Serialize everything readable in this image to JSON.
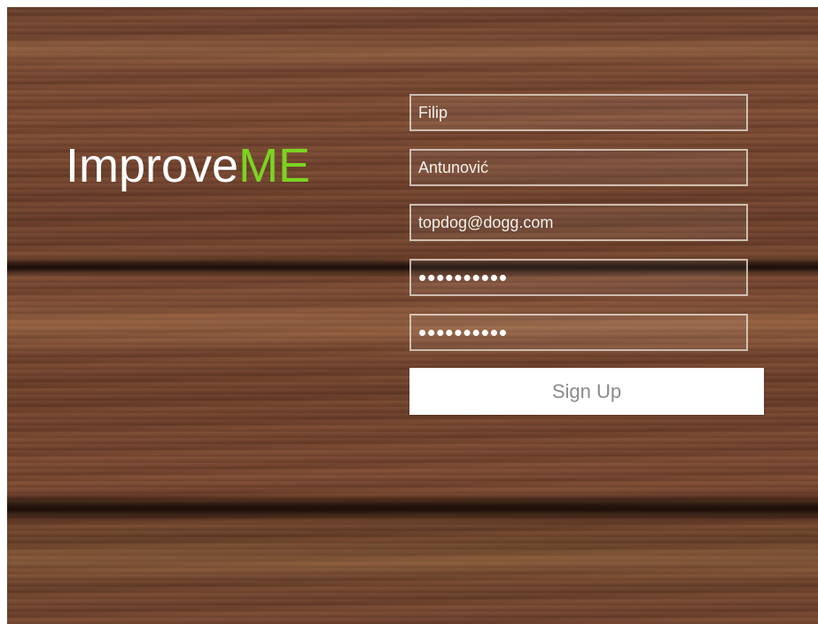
{
  "logo": {
    "text_main": "Improve",
    "text_accent": "ME",
    "accent_color": "#7bd321"
  },
  "form": {
    "first_name": "Filip",
    "last_name": "Antunović",
    "email": "topdog@dogg.com",
    "password": "••••••••••",
    "password_confirm": "••••••••••",
    "submit_label": "Sign Up"
  },
  "colors": {
    "button_bg": "#ffffff",
    "button_text": "#8b8b8b",
    "background": "wood-texture"
  }
}
